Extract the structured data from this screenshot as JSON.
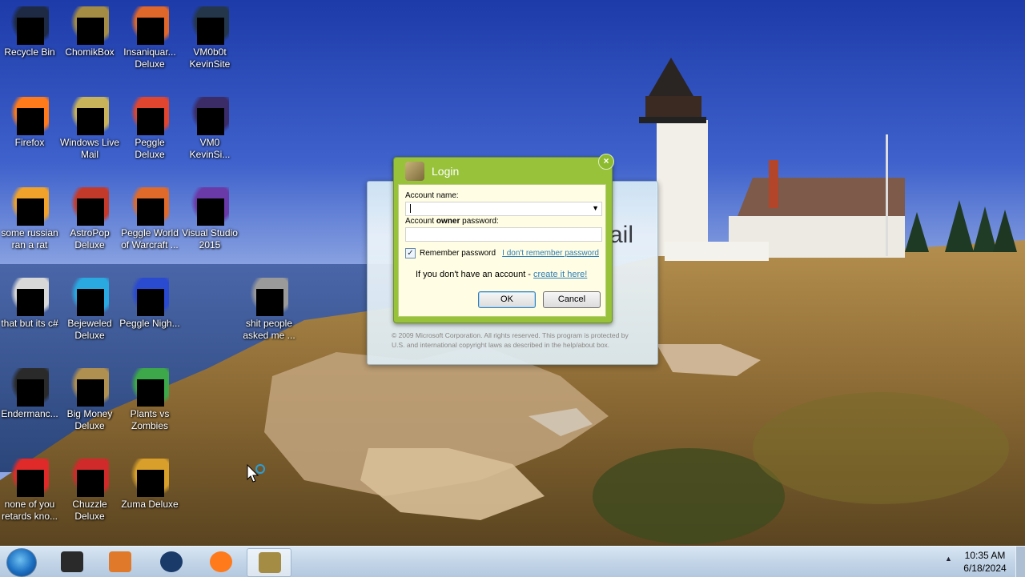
{
  "desktop": {
    "icons": [
      {
        "label": "Recycle Bin",
        "icon": "recycle-bin-icon",
        "color": "#1e2a44"
      },
      {
        "label": "ChomikBox",
        "icon": "chomikbox-icon",
        "color": "#a58c44"
      },
      {
        "label": "Insaniquar... Deluxe",
        "icon": "insaniquarium-icon",
        "color": "#e0672a"
      },
      {
        "label": "VM0b0t KevinSite",
        "icon": "vm0b0t-icon",
        "color": "#24364a"
      },
      {
        "label": "Firefox",
        "icon": "firefox-icon",
        "color": "#ff7a1a"
      },
      {
        "label": "Windows Live Mail",
        "icon": "windows-live-mail-icon",
        "color": "#c9b35a"
      },
      {
        "label": "Peggle Deluxe",
        "icon": "peggle-icon",
        "color": "#e0452f"
      },
      {
        "label": "VM0 KevinSi...",
        "icon": "vm0-icon",
        "color": "#3b2c68"
      },
      {
        "label": "some russian ran a rat",
        "icon": "document-icon",
        "color": "#f0a22a"
      },
      {
        "label": "AstroPop Deluxe",
        "icon": "astropop-icon",
        "color": "#c43a2a"
      },
      {
        "label": "Peggle World of Warcraft ...",
        "icon": "peggle-wow-icon",
        "color": "#e06a2a"
      },
      {
        "label": "Visual Studio 2015",
        "icon": "visual-studio-icon",
        "color": "#6a3aa8"
      },
      {
        "label": "that but its c#",
        "icon": "file-stack-icon",
        "color": "#d8d8d8"
      },
      {
        "label": "Bejeweled Deluxe",
        "icon": "bejeweled-icon",
        "color": "#2aa8e0"
      },
      {
        "label": "Peggle Nigh...",
        "icon": "peggle-nights-icon",
        "color": "#2a4ad0"
      },
      {
        "label": "shit people asked me ...",
        "icon": "folder-icon",
        "color": "#9a9a9a"
      },
      {
        "label": "Endermanc...",
        "icon": "enderman-icon",
        "color": "#2a2a2a"
      },
      {
        "label": "Big Money Deluxe",
        "icon": "big-money-icon",
        "color": "#b09050"
      },
      {
        "label": "Plants vs Zombies",
        "icon": "plants-vs-zombies-icon",
        "color": "#3ca84a"
      },
      {
        "label": "none of you retards kno...",
        "icon": "red-circle-icon",
        "color": "#e02a2a"
      },
      {
        "label": "Chuzzle Deluxe",
        "icon": "chuzzle-icon",
        "color": "#d02a2a"
      },
      {
        "label": "Zuma Deluxe",
        "icon": "zuma-icon",
        "color": "#d8a02a"
      }
    ]
  },
  "wlm": {
    "brand": "ail",
    "copyright": "© 2009 Microsoft Corporation. All rights reserved. This program is protected by U.S. and international copyright laws as described in the help/about box."
  },
  "login": {
    "title": "Login",
    "close": "×",
    "account_name_label": "Account name:",
    "account_name_value": "",
    "password_label_pre": "Account ",
    "password_label_bold": "owner",
    "password_label_post": " password:",
    "password_value": "",
    "remember_checked": true,
    "remember_check_glyph": "✓",
    "remember_label": "Remember password",
    "forgot_link": "I don't remember password",
    "no_account_text": "If you don't have an account - ",
    "create_link": "create it here!",
    "ok_label": "OK",
    "cancel_label": "Cancel"
  },
  "taskbar": {
    "items": [
      {
        "icon": "terminal-icon",
        "color": "#2a2a2a"
      },
      {
        "icon": "media-player-icon",
        "color": "#e07a2a"
      },
      {
        "icon": "globe-icon",
        "color": "#1a3a6a"
      },
      {
        "icon": "firefox-icon",
        "color": "#ff7a1a"
      },
      {
        "icon": "chomikbox-icon",
        "color": "#a58c44",
        "active": true
      }
    ],
    "tray_arrow": "▲",
    "time": "10:35 AM",
    "date": "6/18/2024"
  }
}
